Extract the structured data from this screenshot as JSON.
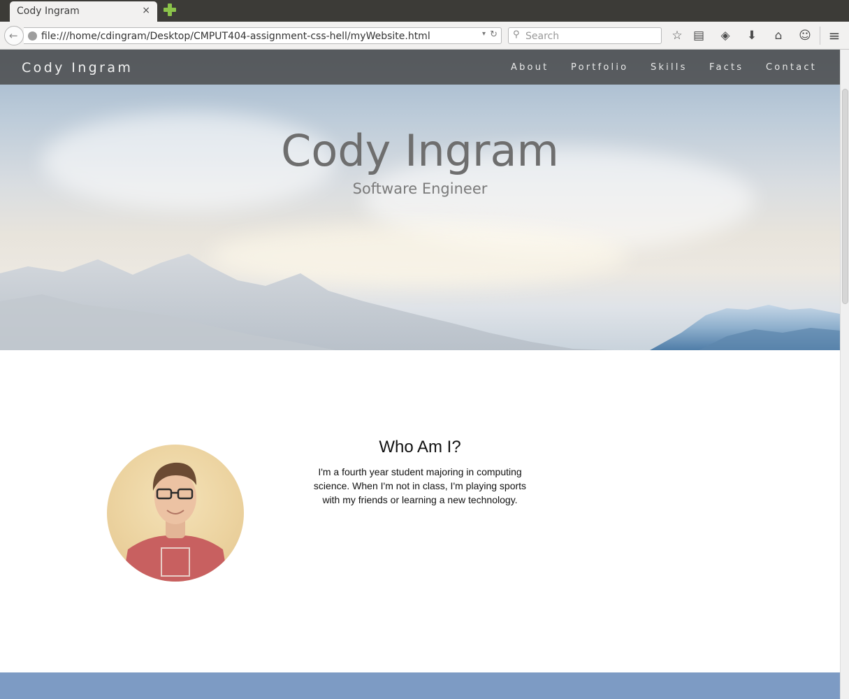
{
  "browser": {
    "tab_title": "Cody Ingram",
    "tab_close": "×",
    "url": "file:///home/cdingram/Desktop/CMPUT404-assignment-css-hell/myWebsite.html",
    "search_placeholder": "Search",
    "icons": {
      "back": "←",
      "url_dropdown": "▾",
      "reload": "↻",
      "search": "⚲",
      "bookmark": "☆",
      "reading_list": "▤",
      "pocket": "◈",
      "downloads": "⬇",
      "home": "⌂",
      "social": "☺",
      "menu": "≡"
    }
  },
  "site": {
    "brand": "Cody Ingram",
    "nav": [
      "About",
      "Portfolio",
      "Skills",
      "Facts",
      "Contact"
    ],
    "hero_title": "Cody Ingram",
    "hero_subtitle": "Software Engineer",
    "about_heading": "Who Am I?",
    "about_text": "I'm a fourth year student majoring in computing science. When I'm not in class, I'm playing sports with my friends or learning a new technology."
  },
  "colors": {
    "nav_bar": "#464646",
    "footer_band": "#7d9bc4",
    "hero_text": "#6e6e6e"
  }
}
